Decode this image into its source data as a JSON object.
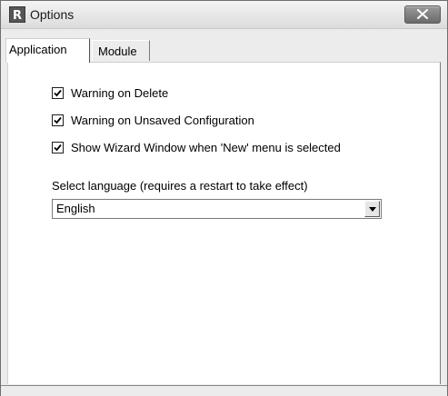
{
  "window": {
    "title": "Options",
    "app_icon_letter": "R"
  },
  "tabs": [
    {
      "label": "Application",
      "active": true
    },
    {
      "label": "Module",
      "active": false
    }
  ],
  "options": [
    {
      "label": "Warning on Delete",
      "checked": true
    },
    {
      "label": "Warning on Unsaved Configuration",
      "checked": true
    },
    {
      "label": "Show Wizard Window when 'New' menu is selected",
      "checked": true
    }
  ],
  "language": {
    "label": "Select language (requires a restart to take effect)",
    "selected": "English"
  },
  "icons": {
    "close": "close-icon",
    "app": "app-icon",
    "check": "check-icon",
    "dropdown": "chevron-down-icon"
  },
  "colors": {
    "title_bar": "#dcdcdc",
    "panel": "#ffffff",
    "close_button": "#7a7a7a"
  }
}
